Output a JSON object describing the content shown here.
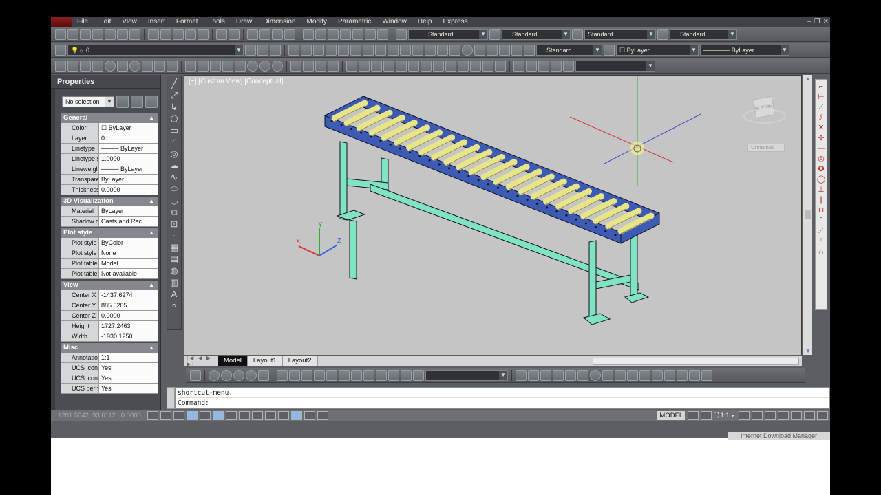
{
  "menu": {
    "items": [
      "File",
      "Edit",
      "View",
      "Insert",
      "Format",
      "Tools",
      "Draw",
      "Dimension",
      "Modify",
      "Parametric",
      "Window",
      "Help",
      "Express"
    ]
  },
  "styles_toolbar": {
    "text_style": "Standard",
    "dim_style": "Standard",
    "table_style": "Standard",
    "mleader_style": "Standard"
  },
  "layers_toolbar": {
    "current_layer": "0",
    "dim_style2": "Standard",
    "color": "ByLayer",
    "linetype": "ByLayer"
  },
  "properties": {
    "title": "Properties",
    "selection": "No selection",
    "categories": [
      {
        "name": "General",
        "rows": [
          {
            "key": "Color",
            "value": "ByLayer"
          },
          {
            "key": "Layer",
            "value": "0"
          },
          {
            "key": "Linetype",
            "value": "ByLayer"
          },
          {
            "key": "Linetype s...",
            "value": "1.0000"
          },
          {
            "key": "Lineweight",
            "value": "ByLayer"
          },
          {
            "key": "Transpare...",
            "value": "ByLayer"
          },
          {
            "key": "Thickness",
            "value": "0.0000"
          }
        ]
      },
      {
        "name": "3D Visualization",
        "rows": [
          {
            "key": "Material",
            "value": "ByLayer"
          },
          {
            "key": "Shadow di...",
            "value": "Casts and Rec..."
          }
        ]
      },
      {
        "name": "Plot style",
        "rows": [
          {
            "key": "Plot style",
            "value": "ByColor"
          },
          {
            "key": "Plot style ...",
            "value": "None"
          },
          {
            "key": "Plot table ...",
            "value": "Model"
          },
          {
            "key": "Plot table ...",
            "value": "Not available"
          }
        ]
      },
      {
        "name": "View",
        "rows": [
          {
            "key": "Center X",
            "value": "-1437.6274"
          },
          {
            "key": "Center Y",
            "value": "885.5205"
          },
          {
            "key": "Center Z",
            "value": "0.0000"
          },
          {
            "key": "Height",
            "value": "1727.2463"
          },
          {
            "key": "Width",
            "value": "-1930.1250"
          }
        ]
      },
      {
        "name": "Misc",
        "rows": [
          {
            "key": "Annotatio...",
            "value": "1:1"
          },
          {
            "key": "UCS icon On",
            "value": "Yes"
          },
          {
            "key": "UCS icon ...",
            "value": "Yes"
          },
          {
            "key": "UCS per vi...",
            "value": "Yes"
          }
        ]
      }
    ]
  },
  "viewport": {
    "label": "[−] [Custom View] [Conceptual]",
    "viewcube_face": "BOTTOM",
    "named_view": "Unnamed",
    "ucs_x": "X",
    "ucs_y": "Y",
    "ucs_z": "Z"
  },
  "layout_tabs": {
    "tabs": [
      {
        "label": "Model",
        "active": true
      },
      {
        "label": "Layout1",
        "active": false
      },
      {
        "label": "Layout2",
        "active": false
      }
    ]
  },
  "command": {
    "history": "shortcut-menu.",
    "prompt": "Command:"
  },
  "status": {
    "coords": "1201.5642, 93.6112 , 0.0000",
    "space": "MODEL",
    "annotation_scale": "1:1"
  },
  "taskbar_ghost": "Internet Download Manager",
  "colors": {
    "viewport_bg": "#c5c5c5",
    "frame": "#3d5bb4",
    "legs": "#7fe3c4",
    "rollers": "#e8e48a",
    "accent": "#8fb9e6"
  }
}
